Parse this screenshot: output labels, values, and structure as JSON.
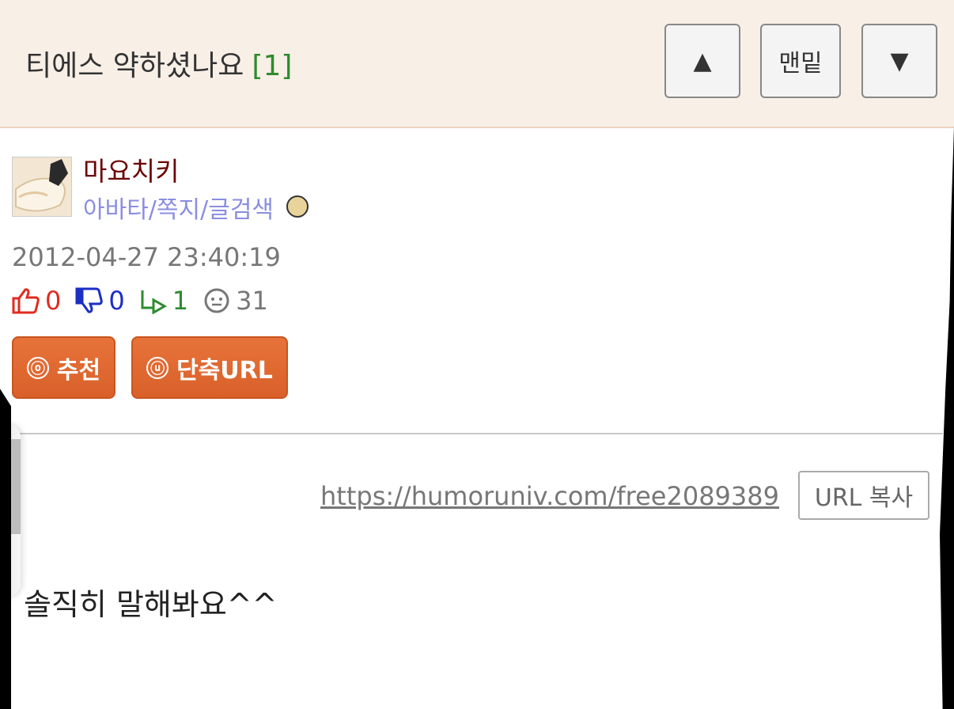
{
  "header": {
    "title": "티에스 약하셨나요",
    "comment_count": "[1]",
    "nav_up_label": "▲",
    "nav_bottom_label": "맨밑",
    "nav_down_label": "▼"
  },
  "author": {
    "name": "마요치키",
    "links": "아바타/쪽지/글검색",
    "date": "2012-04-27 23:40:19"
  },
  "stats": {
    "likes": "0",
    "dislikes": "0",
    "replies": "1",
    "views": "31"
  },
  "buttons": {
    "recommend_icon": "ⓞ",
    "recommend_label": "추천",
    "short_url_icon": "ⓤ",
    "short_url_label": "단축URL",
    "copy_url_label": "URL 복사"
  },
  "post": {
    "url": "https://humoruniv.com/free2089389",
    "body": "솔직히 말해봐요^^"
  },
  "colors": {
    "header_bg": "#f8efe7",
    "accent_orange": "#e06a2f",
    "author_name": "#6b0000",
    "link_purple": "#8a8ee0",
    "green": "#2e8b2e",
    "red": "#e02b20",
    "blue": "#1b2fc4"
  }
}
